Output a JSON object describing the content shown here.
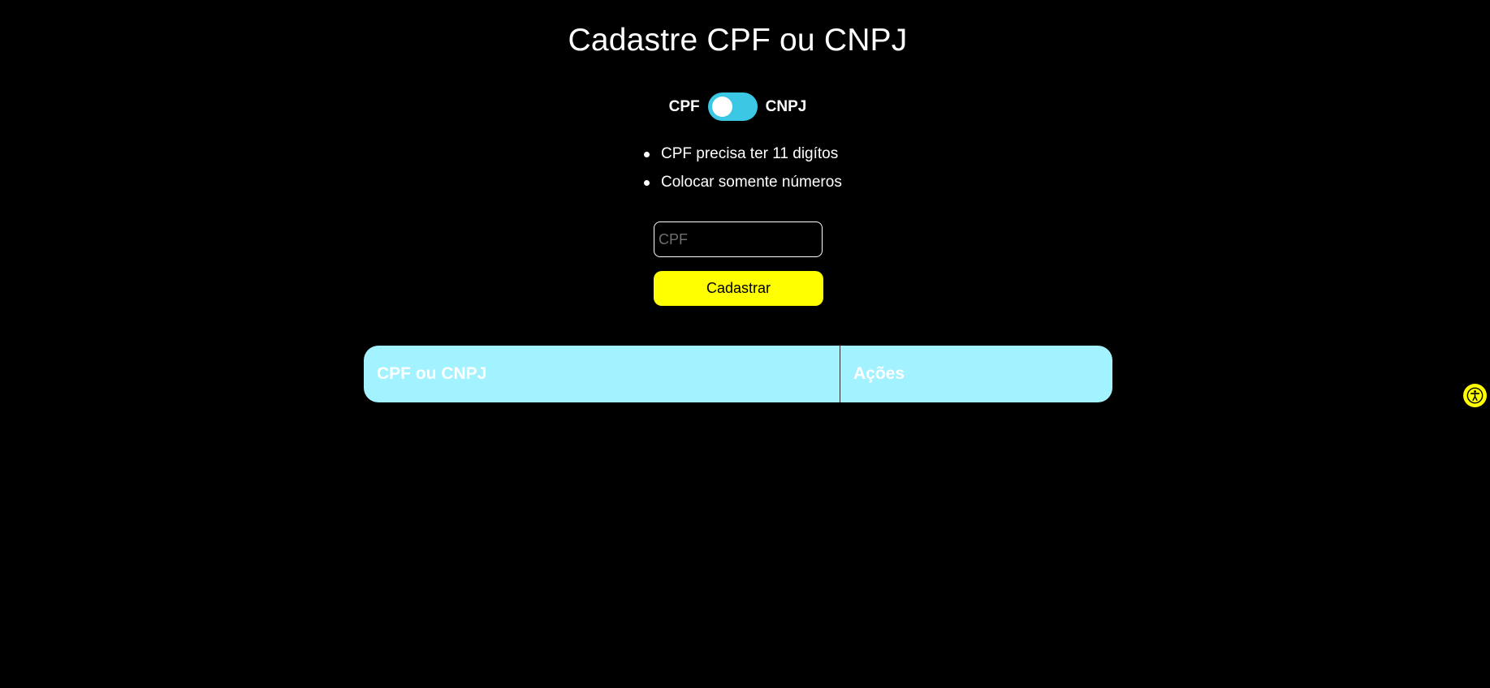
{
  "page": {
    "title": "Cadastre CPF ou CNPJ"
  },
  "toggle": {
    "left_label": "CPF",
    "right_label": "CNPJ",
    "state": "CPF",
    "track_color": "#3ac8e4"
  },
  "rules": [
    "CPF precisa ter 11 digítos",
    "Colocar somente números"
  ],
  "form": {
    "input_value": "",
    "input_placeholder": "CPF",
    "submit_label": "Cadastrar",
    "button_color": "#ffff00"
  },
  "table": {
    "header_color": "#a2f2ff",
    "columns": [
      "CPF ou CNPJ",
      "Ações"
    ],
    "rows": []
  },
  "accessibility": {
    "icon": "accessibility-icon",
    "color": "#ffff00"
  }
}
